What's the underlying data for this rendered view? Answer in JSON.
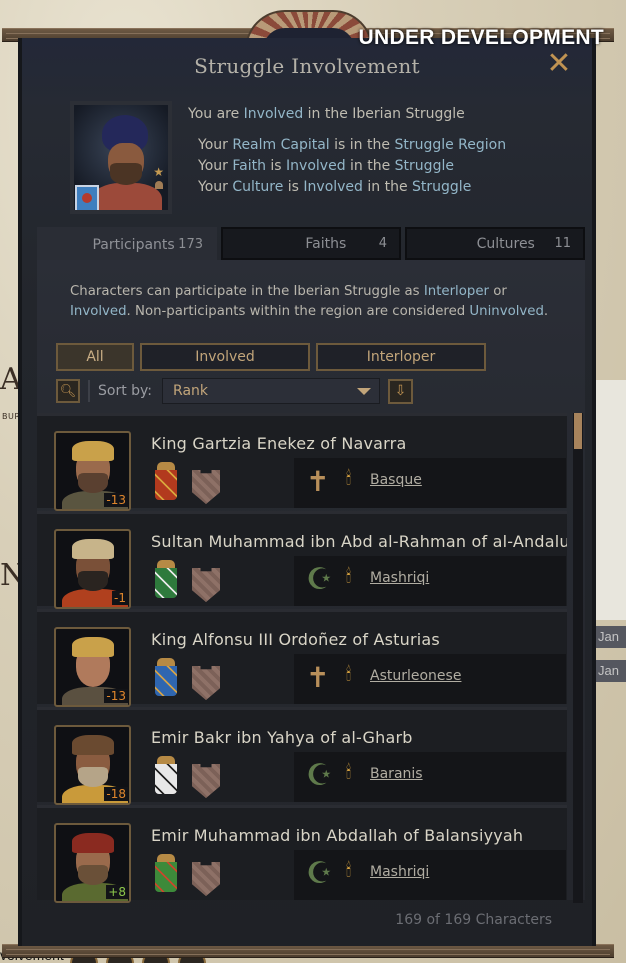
{
  "banner": "UNDER DEVELOPMENT",
  "window": {
    "title": "Struggle Involvement",
    "close_icon": "close-icon"
  },
  "header": {
    "status_prefix": "You are ",
    "status_highlight": "Involved",
    "status_suffix": " in the Iberian Struggle",
    "reasons": [
      {
        "pre": "Your ",
        "hl1": "Realm Capital",
        "mid": " is in the ",
        "hl2": "Struggle Region",
        "post": ""
      },
      {
        "pre": "Your ",
        "hl1": "Faith",
        "mid": " is ",
        "hl2": "Involved",
        "post": " in the ",
        "hl3": "Struggle"
      },
      {
        "pre": "Your ",
        "hl1": "Culture",
        "mid": " is ",
        "hl2": "Involved",
        "post": " in the ",
        "hl3": "Struggle"
      }
    ]
  },
  "tabs": [
    {
      "label": "Participants",
      "count": "173",
      "active": true
    },
    {
      "label": "Faiths",
      "count": "4",
      "active": false
    },
    {
      "label": "Cultures",
      "count": "11",
      "active": false
    }
  ],
  "description": {
    "p1": "Characters can participate in the Iberian Struggle as ",
    "hl1": "Interloper",
    "p2": " or ",
    "hl2": "Involved",
    "p3": ". Non-participants within the region are considered ",
    "hl3": "Uninvolved",
    "p4": "."
  },
  "filters": [
    {
      "label": "All",
      "active": true
    },
    {
      "label": "Involved",
      "active": false
    },
    {
      "label": "Interloper",
      "active": false
    }
  ],
  "sort": {
    "label": "Sort by:",
    "selected": "Rank"
  },
  "characters": [
    {
      "name": "King Gartzia Enekez of Navarra",
      "opinion": "-13",
      "faith_icon": "cross",
      "culture": "Basque",
      "coa_color": "#b23a1e",
      "coa_detail": "#d9a63c"
    },
    {
      "name": "Sultan Muhammad ibn Abd al-Rahman of al-Andalus",
      "opinion": "-1",
      "faith_icon": "crescent",
      "culture": "Mashriqi",
      "coa_color": "#2e7a3c",
      "coa_detail": "#e8e8e8"
    },
    {
      "name": "King Alfonsu III Ordoñez of Asturias",
      "opinion": "-13",
      "faith_icon": "cross",
      "culture": "Asturleonese",
      "coa_color": "#2f66b0",
      "coa_detail": "#d1a24b"
    },
    {
      "name": "Emir Bakr ibn Yahya of al-Gharb",
      "opinion": "-18",
      "faith_icon": "crescent",
      "culture": "Baranis",
      "coa_color": "#e8e8e8",
      "coa_detail": "#222"
    },
    {
      "name": "Emir Muhammad ibn Abdallah of Balansiyyah",
      "opinion": "+8",
      "faith_icon": "crescent",
      "culture": "Mashriqi",
      "coa_color": "#3d8a3a",
      "coa_detail": "#c9472c"
    }
  ],
  "footer": {
    "count": "169 of 169 Characters"
  },
  "map": {
    "jan_labels": [
      "Jan",
      "Jan"
    ],
    "letters": [
      "A",
      "N"
    ],
    "burg": "BURG",
    "bottom_label": "volvement"
  }
}
